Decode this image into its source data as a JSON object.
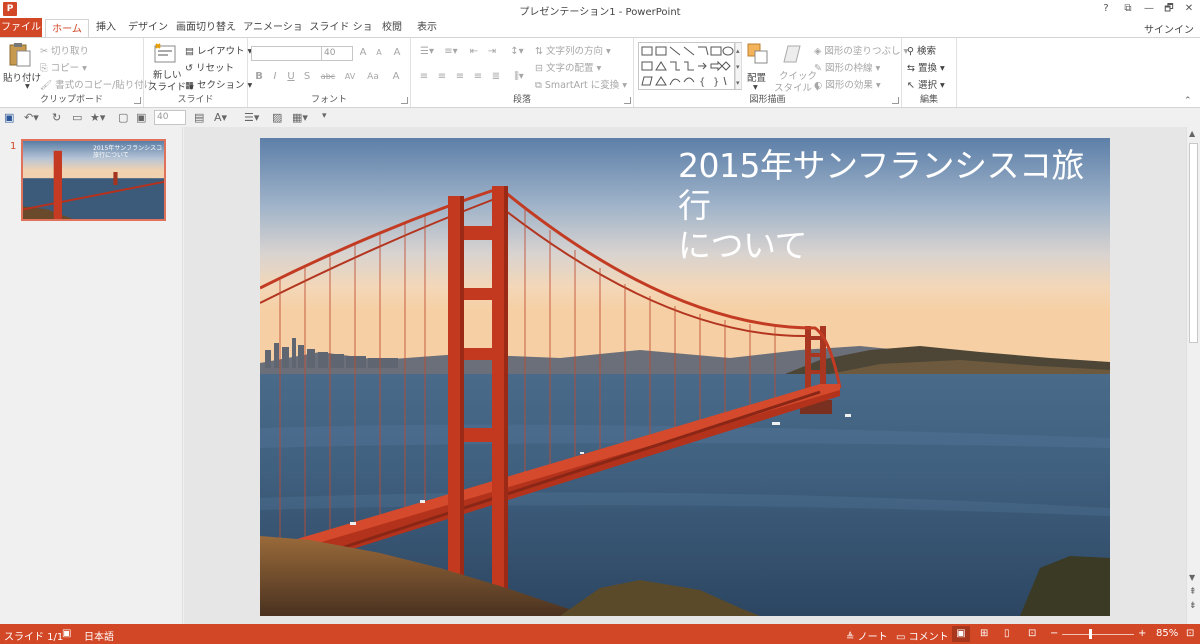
{
  "window": {
    "app_icon": "P",
    "title": "プレゼンテーション1 - PowerPoint",
    "help": "?",
    "restore_ribbon": "⧉",
    "minimize": "—",
    "maximize": "🗗",
    "close": "✕"
  },
  "tabs": [
    {
      "label": "ファイル"
    },
    {
      "label": "ホーム"
    },
    {
      "label": "挿入"
    },
    {
      "label": "デザイン"
    },
    {
      "label": "画面切り替え"
    },
    {
      "label": "アニメーション"
    },
    {
      "label": "スライド ショー"
    },
    {
      "label": "校閲"
    },
    {
      "label": "表示"
    }
  ],
  "signin": "サインイン",
  "ribbon": {
    "clipboard": {
      "paste": "貼り付け",
      "cut": "切り取り",
      "copy": "コピー",
      "format_painter": "書式のコピー/貼り付け",
      "label": "クリップボード"
    },
    "slides": {
      "new_slide_1": "新しい",
      "new_slide_2": "スライド",
      "layout": "レイアウト",
      "reset": "リセット",
      "section": "セクション",
      "label": "スライド"
    },
    "font": {
      "font_size": "40",
      "grow": "A",
      "shrink": "A",
      "clear": "A",
      "bold": "B",
      "italic": "I",
      "underline": "U",
      "shadow": "S",
      "strike": "abc",
      "spacing": "AV",
      "case": "Aa",
      "color": "A",
      "label": "フォント"
    },
    "paragraph": {
      "text_direction": "文字列の方向",
      "align_text": "文字の配置",
      "smartart": "SmartArt に変換",
      "label": "段落"
    },
    "drawing": {
      "arrange": "配置",
      "quick_styles_1": "クイック",
      "quick_styles_2": "スタイル",
      "fill": "図形の塗りつぶし",
      "outline": "図形の枠線",
      "effects": "図形の効果",
      "label": "図形描画"
    },
    "editing": {
      "find": "検索",
      "replace": "置換",
      "select": "選択",
      "label": "編集"
    }
  },
  "qat": {
    "font_size": "40"
  },
  "thumbnail": {
    "number": "1",
    "title": "2015年サンフランシスコ旅行について"
  },
  "slide": {
    "title_line1": "2015年サンフランシスコ旅行",
    "title_line2": "について"
  },
  "status": {
    "slide_info": "スライド 1/1",
    "language": "日本語",
    "notes": "ノート",
    "comments": "コメント",
    "zoom": "85%"
  },
  "colors": {
    "accent": "#d24726"
  }
}
